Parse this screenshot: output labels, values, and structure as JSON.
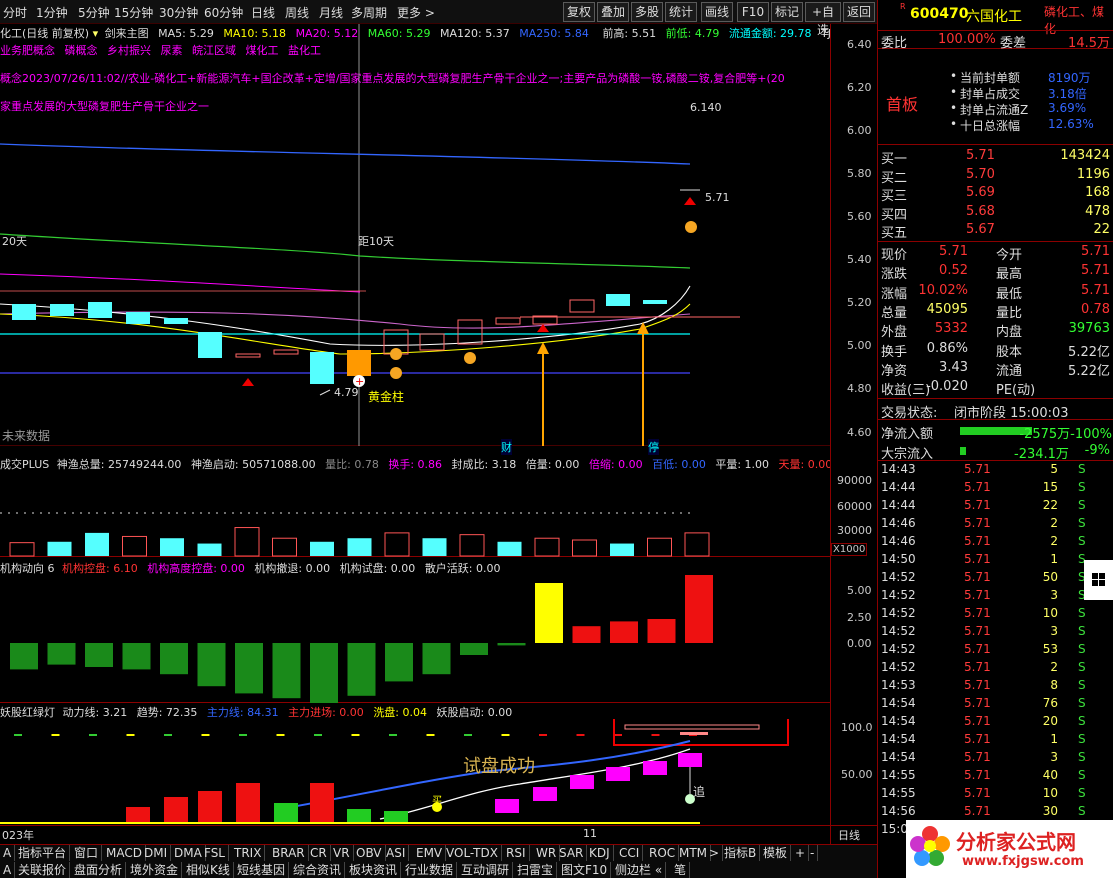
{
  "toolbar": {
    "periods": [
      "分时",
      "1分钟",
      "5分钟",
      "15分钟",
      "30分钟",
      "60分钟",
      "日线",
      "周线",
      "月线",
      "多周期",
      "更多 >"
    ],
    "buttons": [
      "复权",
      "叠加",
      "多股",
      "统计",
      "画线",
      "F10",
      "标记",
      "+自选",
      "返回"
    ]
  },
  "header_info": {
    "stock": "化工(日线 前复权)",
    "indicator": "剑来主图",
    "ma5": "MA5: 5.29",
    "ma10": "MA10: 5.18",
    "ma20": "MA20: 5.12",
    "ma60": "MA60: 5.29",
    "ma120": "MA120: 5.37",
    "ma250": "MA250: 5.84",
    "prev_high": "前高: 5.51",
    "prev_low": "前低: 4.79",
    "flow_cap": "流通金额: 29.78",
    "tj": "TJ: "
  },
  "concepts": {
    "line1": "业务肥概念",
    "line1b": "磷概念",
    "line1c": "乡村振兴",
    "line1d": "尿素",
    "line1e": "皖江区域",
    "line1f": "煤化工",
    "line1g": "盐化工",
    "line2": "概念2023/07/26/11:02//农业-磷化工+新能源汽车+国企改革+定增/国家重点发展的大型磷复肥生产骨干企业之一;主要产品为磷酸一铵,磷酸二铵,复合肥等+(20",
    "line3": "家重点发展的大型磷复肥生产骨干企业之一"
  },
  "main_chart": {
    "labels": {
      "days20": "20天",
      "days10": "距10天",
      "high_label": "6.140",
      "last_price": "5.71",
      "low_label": "4.79",
      "golden": "黄金柱",
      "future": "未来数据",
      "cai": "财",
      "ting": "停"
    },
    "y_ticks": [
      "6.40",
      "6.20",
      "6.00",
      "5.80",
      "5.60",
      "5.40",
      "5.20",
      "5.00",
      "4.80",
      "4.60"
    ]
  },
  "vol_panel": {
    "title": "成交PLUS",
    "f1": "神渔总量: 25749244.00",
    "f2": "神渔启动: 50571088.00",
    "f3": "量比: 0.78",
    "f4": "换手: 0.86",
    "f5": "封成比: 3.18",
    "f6": "倍量: 0.00",
    "f7": "倍缩: 0.00",
    "f8": "百低: 0.00",
    "f9": "平量: 1.00",
    "f10": "天量: 0.00",
    "f11": "量",
    "y_ticks": [
      "90000",
      "60000",
      "30000"
    ],
    "unit": "X1000",
    "values": [
      15000,
      16000,
      26000,
      22000,
      20000,
      14000,
      32000,
      20000,
      16000,
      20000,
      26000,
      20000,
      24000,
      16000,
      20000,
      18000,
      14000,
      20000,
      26000,
      26000,
      26000,
      48000,
      28000,
      26000
    ]
  },
  "inst_panel": {
    "title": "机构动向 6",
    "f1": "机构控盘: 6.10",
    "f2": "机构高度控盘: 0.00",
    "f3": "机构撤退: 0.00",
    "f4": "机构试盘: 0.00",
    "f5": "散户活跃: 0.00",
    "y_ticks": [
      "5.00",
      "2.50",
      "0.00"
    ],
    "values": [
      -2.2,
      -1.8,
      -2.0,
      -2.2,
      -2.6,
      -3.6,
      -4.2,
      -4.6,
      -5.8,
      -4.4,
      -3.2,
      -2.6,
      -1.0,
      -0.2,
      5.0,
      1.4,
      1.8,
      2.0,
      6.2
    ]
  },
  "demon_panel": {
    "title": "妖股红绿灯",
    "f1": "动力线: 3.21",
    "f2": "趋势: 72.35",
    "f3": "主力线: 84.31",
    "f4": "主力进场: 0.00",
    "f5": "洗盘: 0.04",
    "f6": "妖股启动: 0.00",
    "y_ticks": [
      "100.0",
      "50.00"
    ],
    "annotation": "试盘成功",
    "mai": "买",
    "zhui": "追"
  },
  "bottom_axis": {
    "year": "023年",
    "eleven": "11",
    "day": "日线"
  },
  "bottom_tabs": {
    "row1": [
      "A",
      "指标平台",
      "窗口",
      "MACD",
      "DMI",
      "DMA",
      "FSL",
      "TRIX",
      "BRAR",
      "CR",
      "VR",
      "OBV",
      "ASI",
      "EMV",
      "VOL-TDX",
      "RSI",
      "WR",
      "SAR",
      "KDJ",
      "CCI",
      "ROC",
      "MTM",
      ">",
      "指标B",
      "模板",
      "+",
      "-"
    ],
    "row2": [
      "A",
      "关联报价",
      "盘面分析",
      "境外资金",
      "相似K线",
      "短线基因",
      "综合资讯",
      "板块资讯",
      "行业数据",
      "互动调研",
      "扫雷宝",
      "图文F10",
      "侧边栏 «",
      "笔"
    ]
  },
  "quote": {
    "code": "600470",
    "name": "六国化工",
    "tag": "磷化工、煤化",
    "weibi_label": "委比",
    "weibi_val": "100.00%",
    "weicha_label": "委差",
    "weicha_val": "14.5万",
    "shouban": "首板",
    "seal": [
      {
        "label": "当前封单额",
        "val": "8190万"
      },
      {
        "label": "封单占成交",
        "val": "3.18倍"
      },
      {
        "label": "封单占流通Z",
        "val": "3.69%"
      },
      {
        "label": "十日总涨幅",
        "val": "12.63%"
      }
    ],
    "bids": [
      {
        "label": "买一",
        "price": "5.71",
        "vol": "143424"
      },
      {
        "label": "买二",
        "price": "5.70",
        "vol": "1196"
      },
      {
        "label": "买三",
        "price": "5.69",
        "vol": "168"
      },
      {
        "label": "买四",
        "price": "5.68",
        "vol": "478"
      },
      {
        "label": "买五",
        "price": "5.67",
        "vol": "22"
      }
    ],
    "stats": [
      {
        "l1": "现价",
        "v1": "5.71",
        "l2": "今开",
        "v2": "5.71"
      },
      {
        "l1": "涨跌",
        "v1": "0.52",
        "l2": "最高",
        "v2": "5.71"
      },
      {
        "l1": "涨幅",
        "v1": "10.02%",
        "l2": "最低",
        "v2": "5.71"
      },
      {
        "l1": "总量",
        "v1": "45095",
        "l2": "量比",
        "v2": "0.78"
      },
      {
        "l1": "外盘",
        "v1": "5332",
        "l2": "内盘",
        "v2": "39763"
      },
      {
        "l1": "换手",
        "v1": "0.86%",
        "l2": "股本",
        "v2": "5.22亿"
      },
      {
        "l1": "净资",
        "v1": "3.43",
        "l2": "流通",
        "v2": "5.22亿"
      },
      {
        "l1": "收益(三)",
        "v1": "-0.020",
        "l2": "PE(动)",
        "v2": ""
      }
    ],
    "trade_state_label": "交易状态:",
    "trade_state_val": "闭市阶段 15:00:03",
    "netflow_label": "净流入额",
    "netflow_val": "-2575万-100%",
    "block_label": "大宗流入",
    "block_val": "-234.1万",
    "block_pct": "-9%",
    "ticks": [
      {
        "t": "14:43",
        "p": "5.71",
        "v": "5",
        "s": "S"
      },
      {
        "t": "14:44",
        "p": "5.71",
        "v": "15",
        "s": "S"
      },
      {
        "t": "14:44",
        "p": "5.71",
        "v": "22",
        "s": "S"
      },
      {
        "t": "14:46",
        "p": "5.71",
        "v": "2",
        "s": "S"
      },
      {
        "t": "14:46",
        "p": "5.71",
        "v": "2",
        "s": "S"
      },
      {
        "t": "14:50",
        "p": "5.71",
        "v": "1",
        "s": "S"
      },
      {
        "t": "14:52",
        "p": "5.71",
        "v": "50",
        "s": "S"
      },
      {
        "t": "14:52",
        "p": "5.71",
        "v": "3",
        "s": "S"
      },
      {
        "t": "14:52",
        "p": "5.71",
        "v": "10",
        "s": "S"
      },
      {
        "t": "14:52",
        "p": "5.71",
        "v": "3",
        "s": "S"
      },
      {
        "t": "14:52",
        "p": "5.71",
        "v": "53",
        "s": "S"
      },
      {
        "t": "14:52",
        "p": "5.71",
        "v": "2",
        "s": "S"
      },
      {
        "t": "14:53",
        "p": "5.71",
        "v": "8",
        "s": "S"
      },
      {
        "t": "14:54",
        "p": "5.71",
        "v": "76",
        "s": "S"
      },
      {
        "t": "14:54",
        "p": "5.71",
        "v": "20",
        "s": "S"
      },
      {
        "t": "14:54",
        "p": "5.71",
        "v": "1",
        "s": "S"
      },
      {
        "t": "14:54",
        "p": "5.71",
        "v": "3",
        "s": "S"
      },
      {
        "t": "14:55",
        "p": "5.71",
        "v": "40",
        "s": "S"
      },
      {
        "t": "14:55",
        "p": "5.71",
        "v": "10",
        "s": "S"
      },
      {
        "t": "14:56",
        "p": "5.71",
        "v": "30",
        "s": "S"
      }
    ],
    "last_time": "15:0",
    "logo_text": "分析家公式网",
    "logo_url": "www.fxjgsw.com"
  }
}
